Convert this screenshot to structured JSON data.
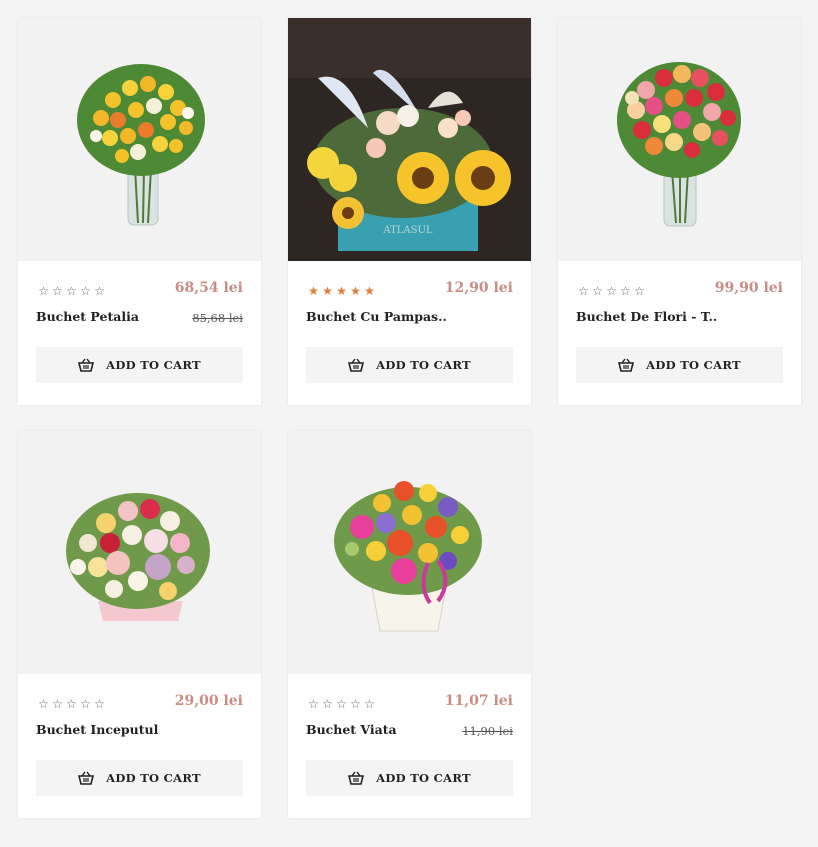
{
  "products": [
    {
      "name": "Buchet Petalia",
      "price": "68,54 lei",
      "old_price": "85,68 lei",
      "rating": 0,
      "rating_stars": [
        "☆",
        "☆",
        "☆",
        "☆",
        "☆"
      ],
      "add_to_cart_label": "ADD TO CART",
      "image_icon": "bouquet-yellow-roses-vase-icon"
    },
    {
      "name": "Buchet Cu Pampas...",
      "price": "12,90 lei",
      "old_price": "",
      "rating": 5,
      "rating_stars": [
        "★",
        "★",
        "★",
        "★",
        "★"
      ],
      "add_to_cart_label": "ADD TO CART",
      "image_icon": "sunflower-box-arrangement-icon",
      "box_label": "ATLASUL"
    },
    {
      "name": "Buchet De Flori - T...",
      "price": "99,90 lei",
      "old_price": "",
      "rating": 0,
      "rating_stars": [
        "☆",
        "☆",
        "☆",
        "☆",
        "☆"
      ],
      "add_to_cart_label": "ADD TO CART",
      "image_icon": "bouquet-mixed-roses-vase-icon"
    },
    {
      "name": "Buchet Inceputul",
      "price": "29,00 lei",
      "old_price": "",
      "rating": 0,
      "rating_stars": [
        "☆",
        "☆",
        "☆",
        "☆",
        "☆"
      ],
      "add_to_cart_label": "ADD TO CART",
      "image_icon": "pastel-roses-box-icon"
    },
    {
      "name": "Buchet Viata",
      "price": "11,07 lei",
      "old_price": "11,90 lei",
      "rating": 0,
      "rating_stars": [
        "☆",
        "☆",
        "☆",
        "☆",
        "☆"
      ],
      "add_to_cart_label": "ADD TO CART",
      "image_icon": "gerbera-basket-icon"
    }
  ],
  "colors": {
    "price": "#c98d86",
    "star_filled": "#e07c3c",
    "button_bg": "#f4f4f4",
    "page_bg": "#f4f4f4"
  }
}
